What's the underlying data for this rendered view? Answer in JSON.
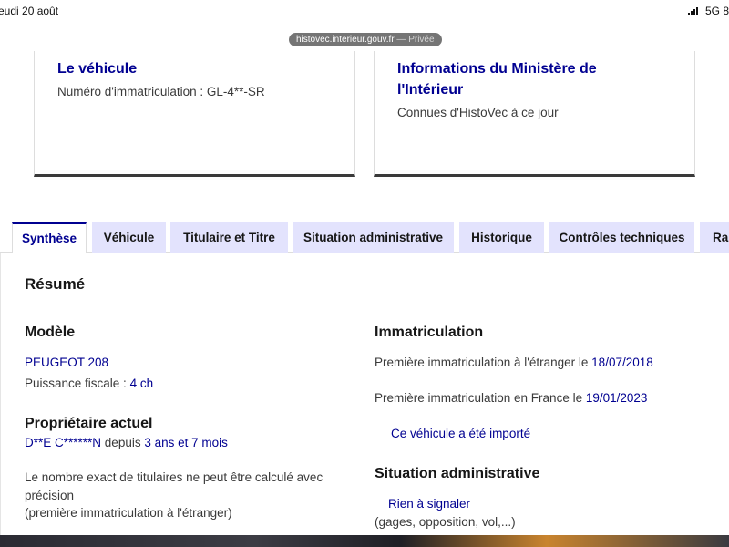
{
  "status": {
    "date": "eudi 20 août",
    "network": "5G 8",
    "url": "histovec.interieur.gouv.fr",
    "private_label": " — Privée"
  },
  "cards": {
    "vehicle": {
      "title": "Le véhicule",
      "plate_label": "Numéro d'immatriculation : GL-4**-SR"
    },
    "ministry": {
      "title_line1": "Informations du Ministère de",
      "title_line2": "l'Intérieur",
      "text": "Connues d'HistoVec à ce jour"
    }
  },
  "tabs": [
    {
      "label": "Synthèse",
      "active": true
    },
    {
      "label": "Véhicule"
    },
    {
      "label": "Titulaire et Titre"
    },
    {
      "label": "Situation administrative"
    },
    {
      "label": "Historique"
    },
    {
      "label": "Contrôles techniques"
    },
    {
      "label": "Rap"
    }
  ],
  "summary": {
    "heading": "Résumé",
    "model": {
      "heading": "Modèle",
      "name": "PEUGEOT 208",
      "power_label": "Puissance fiscale : ",
      "power_value": "4 ch"
    },
    "owner": {
      "heading": "Propriétaire actuel",
      "name": "D**E C******N",
      "since_label": " depuis ",
      "since_value": "3 ans et 7 mois",
      "note_line1": "Le nombre exact de titulaires ne peut être calculé avec",
      "note_line2": "précision",
      "note_line3": "(première immatriculation à l'étranger)"
    },
    "registration": {
      "heading": "Immatriculation",
      "foreign_label": "Première immatriculation à l'étranger le ",
      "foreign_date": "18/07/2018",
      "france_label": "Première immatriculation en France le ",
      "france_date": "19/01/2023",
      "imported_link": "Ce véhicule a été importé"
    },
    "admin": {
      "heading": "Situation administrative",
      "status": "Rien à signaler",
      "details": "(gages, opposition, vol,...)"
    }
  }
}
